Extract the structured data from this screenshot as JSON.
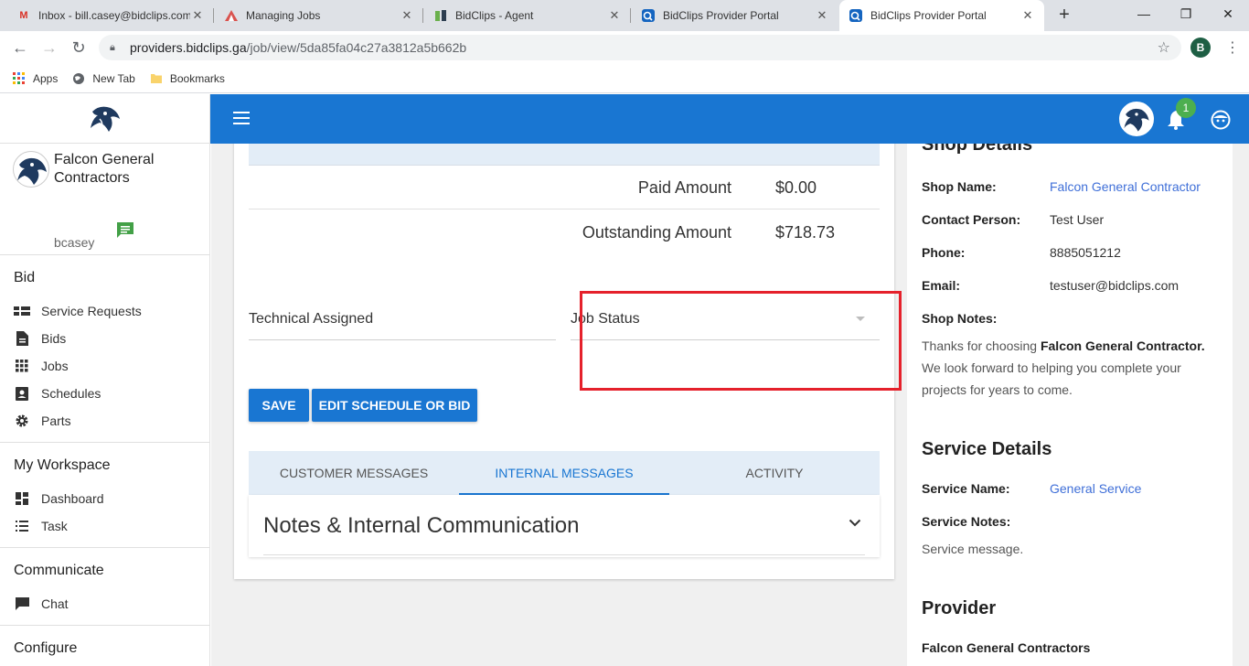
{
  "browser": {
    "tabs": [
      {
        "title": "Inbox - bill.casey@bidclips.com",
        "icon": "gmail-icon",
        "color": "#d93025"
      },
      {
        "title": "Managing Jobs",
        "icon": "managing-icon",
        "color": "#d9534f"
      },
      {
        "title": "BidClips - Agent",
        "icon": "bidclips-agent-icon",
        "color": "#6ab04c"
      },
      {
        "title": "BidClips Provider Portal",
        "icon": "provider-portal-icon",
        "color": "#1565c0"
      },
      {
        "title": "BidClips Provider Portal",
        "icon": "provider-portal-icon",
        "color": "#1565c0"
      }
    ],
    "url_host": "providers.bidclips.ga",
    "url_path": "/job/view/5da85fa04c27a3812a5b662b",
    "profile_initial": "B",
    "bookmarks": [
      "Apps",
      "New Tab",
      "Bookmarks"
    ]
  },
  "sidebar": {
    "company": "Falcon General Contractors",
    "username": "bcasey",
    "sections": [
      {
        "heading": "Bid",
        "items": [
          "Service Requests",
          "Bids",
          "Jobs",
          "Schedules",
          "Parts"
        ]
      },
      {
        "heading": "My Workspace",
        "items": [
          "Dashboard",
          "Task"
        ]
      },
      {
        "heading": "Communicate",
        "items": [
          "Chat"
        ]
      },
      {
        "heading": "Configure",
        "items": []
      }
    ]
  },
  "header": {
    "notification_count": "1"
  },
  "payment": {
    "paid_label": "Paid Amount",
    "paid_value": "$0.00",
    "outstanding_label": "Outstanding Amount",
    "outstanding_value": "$718.73"
  },
  "form": {
    "technical_label": "Technical Assigned",
    "job_status_label": "Job Status",
    "save_label": "SAVE",
    "edit_label": "EDIT SCHEDULE OR BID"
  },
  "message_tabs": [
    "CUSTOMER MESSAGES",
    "INTERNAL MESSAGES",
    "ACTIVITY"
  ],
  "active_tab": 1,
  "notes_title": "Notes & Internal Communication",
  "shop": {
    "heading": "Shop Details",
    "name_label": "Shop Name:",
    "name_value": "Falcon General Contractor",
    "contact_label": "Contact Person:",
    "contact_value": "Test User",
    "phone_label": "Phone:",
    "phone_value": "8885051212",
    "email_label": "Email:",
    "email_value": "testuser@bidclips.com",
    "notes_label": "Shop Notes:",
    "notes_pre": "Thanks for choosing ",
    "notes_bold": "Falcon General Contractor.",
    "notes_post": " We look forward to helping you complete your projects for years to come."
  },
  "service": {
    "heading": "Service Details",
    "name_label": "Service Name:",
    "name_value": "General Service",
    "notes_label": "Service Notes:",
    "notes_value": "Service message."
  },
  "provider": {
    "heading": "Provider",
    "name": "Falcon General Contractors"
  },
  "colors": {
    "primary": "#1976d2",
    "highlight": "#e5212b",
    "badge": "#4caf50",
    "link": "#3f6fd8"
  }
}
